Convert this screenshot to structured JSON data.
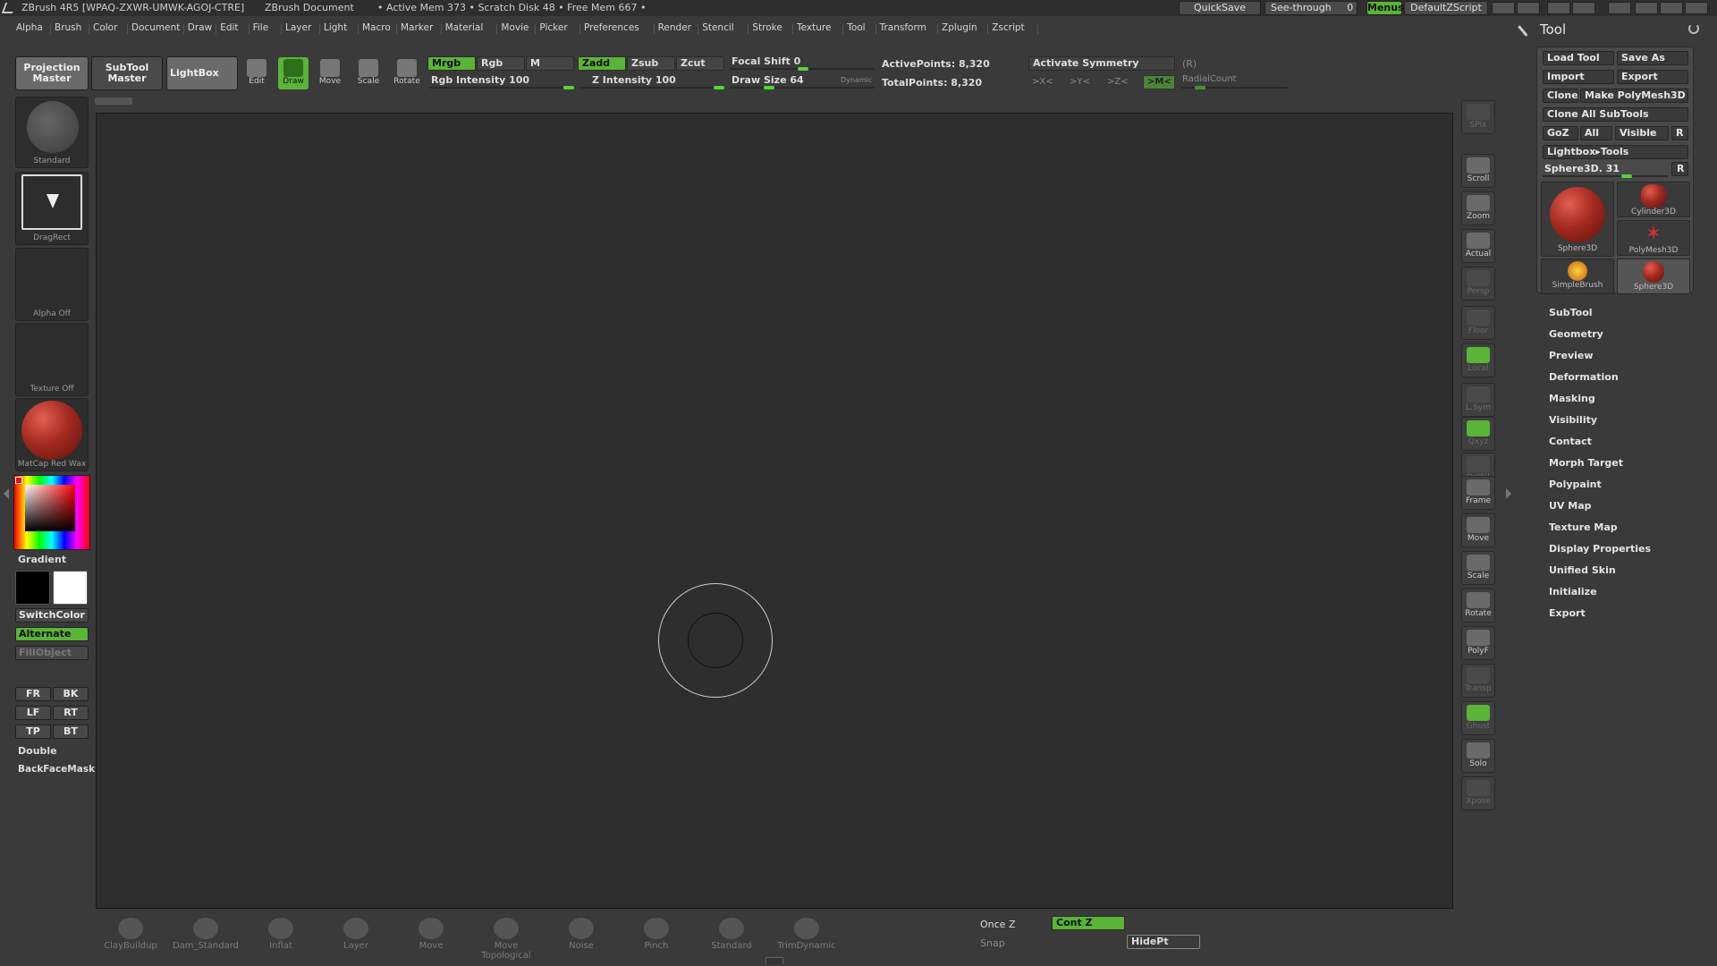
{
  "titlebar": {
    "app": "ZBrush 4R5 [WPAQ-ZXWR-UMWK-AGOJ-CTRE]",
    "document": "ZBrush Document",
    "mem": "• Active Mem 373 • Scratch Disk 48 • Free Mem 667 •",
    "quicksave": "QuickSave",
    "seethrough": "See-through",
    "seethrough_value": "0",
    "menus": "Menus",
    "zscript": "DefaultZScript"
  },
  "menubar": [
    "Alpha",
    "Brush",
    "Color",
    "Document",
    "Draw",
    "Edit",
    "File",
    "Layer",
    "Light",
    "Macro",
    "Marker",
    "Material",
    "Movie",
    "Picker",
    "Preferences",
    "Render",
    "Stencil",
    "Stroke",
    "Texture",
    "Tool",
    "Transform",
    "Zplugin",
    "Zscript"
  ],
  "shelf": {
    "projection_master": [
      "Projection",
      "Master"
    ],
    "subtool_master": [
      "SubTool",
      "Master"
    ],
    "lightbox": "LightBox",
    "modes": [
      {
        "label": "Edit",
        "icon": "edit-icon"
      },
      {
        "label": "Draw",
        "icon": "draw-icon"
      },
      {
        "label": "Move",
        "icon": "move-icon"
      },
      {
        "label": "Scale",
        "icon": "scale-icon"
      },
      {
        "label": "Rotate",
        "icon": "rotate-icon"
      }
    ],
    "mrgb": "Mrgb",
    "rgb": "Rgb",
    "m": "M",
    "zadd": "Zadd",
    "zsub": "Zsub",
    "zcut": "Zcut",
    "rgb_intensity": "Rgb Intensity 100",
    "z_intensity": "Z Intensity 100",
    "focal_shift": "Focal Shift 0",
    "draw_size": "Draw Size 64",
    "dynamic": "Dynamic",
    "active_points": "ActivePoints: 8,320",
    "total_points": "TotalPoints: 8,320",
    "activate_symmetry": "Activate Symmetry",
    "r_label": "(R)",
    "sym_x": ">X<",
    "sym_y": ">Y<",
    "sym_z": ">Z<",
    "sym_m": ">M<",
    "radial_count": "RadialCount"
  },
  "left": {
    "brush_caption": "Standard",
    "stroke_caption": "DragRect",
    "alpha_caption": "Alpha Off",
    "texture_caption": "Texture Off",
    "material_caption": "MatCap Red Wax",
    "gradient": "Gradient",
    "switchcolor": "SwitchColor",
    "alternate": "Alternate",
    "fillobject": "FillObject",
    "views": [
      "FR",
      "BK",
      "LF",
      "RT",
      "TP",
      "BT"
    ],
    "double": "Double",
    "backfacemask": "BackFaceMask"
  },
  "right_toolbar": [
    {
      "label": "SPix",
      "icon": "spix-icon",
      "dim": true
    },
    {
      "label": "Scroll",
      "icon": "scroll-icon",
      "dim": false
    },
    {
      "label": "Zoom",
      "icon": "zoom-icon",
      "dim": false
    },
    {
      "label": "Actual",
      "icon": "actual-icon",
      "dim": false
    },
    {
      "label": "Persp",
      "icon": "persp-icon",
      "dim": true
    },
    {
      "label": "Floor",
      "icon": "floor-icon",
      "dim": true
    },
    {
      "label": "Local",
      "icon": "local-icon",
      "dim": true
    },
    {
      "label": "L.Sym",
      "icon": "lsym-icon",
      "dim": true
    },
    {
      "label": "Qxyz",
      "icon": "xyz-icon",
      "dim": true
    },
    {
      "label": "Delfill",
      "icon": "delfill-icon",
      "dim": true
    },
    {
      "label": "Frame",
      "icon": "frame-icon",
      "dim": false
    },
    {
      "label": "Move",
      "icon": "move-icon",
      "dim": false
    },
    {
      "label": "Scale",
      "icon": "scale-icon",
      "dim": false
    },
    {
      "label": "Rotate",
      "icon": "rotate-icon",
      "dim": false
    },
    {
      "label": "PolyF",
      "icon": "polyf-icon",
      "dim": false
    },
    {
      "label": "Transp",
      "icon": "transp-icon",
      "dim": true
    },
    {
      "label": "Ghost",
      "icon": "ghost-icon",
      "dim": true
    },
    {
      "label": "Solo",
      "icon": "solo-icon",
      "dim": false
    },
    {
      "label": "Xpose",
      "icon": "xpose-icon",
      "dim": true
    }
  ],
  "tool": {
    "title": "Tool",
    "load": "Load Tool",
    "save": "Save As",
    "import": "Import",
    "export": "Export",
    "clone": "Clone",
    "make": "Make PolyMesh3D",
    "clone_all": "Clone All SubTools",
    "goz": "GoZ",
    "all": "All",
    "visible": "Visible",
    "r": "R",
    "lightbox_tools": "Lightbox▸Tools",
    "current": "Sphere3D. 31",
    "thumbs": [
      "Sphere3D",
      "Cylinder3D",
      "PolyMesh3D",
      "SimpleBrush",
      "Sphere3D"
    ]
  },
  "tool_sections": [
    "SubTool",
    "Geometry",
    "Preview",
    "Deformation",
    "Masking",
    "Visibility",
    "Contact",
    "Morph Target",
    "Polypaint",
    "UV Map",
    "Texture Map",
    "Display Properties",
    "Unified Skin",
    "Initialize",
    "Export"
  ],
  "bottom_brushes": [
    "ClayBuildup",
    "Dam_Standard",
    "Inflat",
    "Layer",
    "Move",
    "Move Topological",
    "Noise",
    "Pinch",
    "Standard",
    "TrimDynamic"
  ],
  "bottom_right": {
    "once_z": "Once Z",
    "cont_z": "Cont Z",
    "snap": "Snap",
    "hidept": "HidePt"
  }
}
